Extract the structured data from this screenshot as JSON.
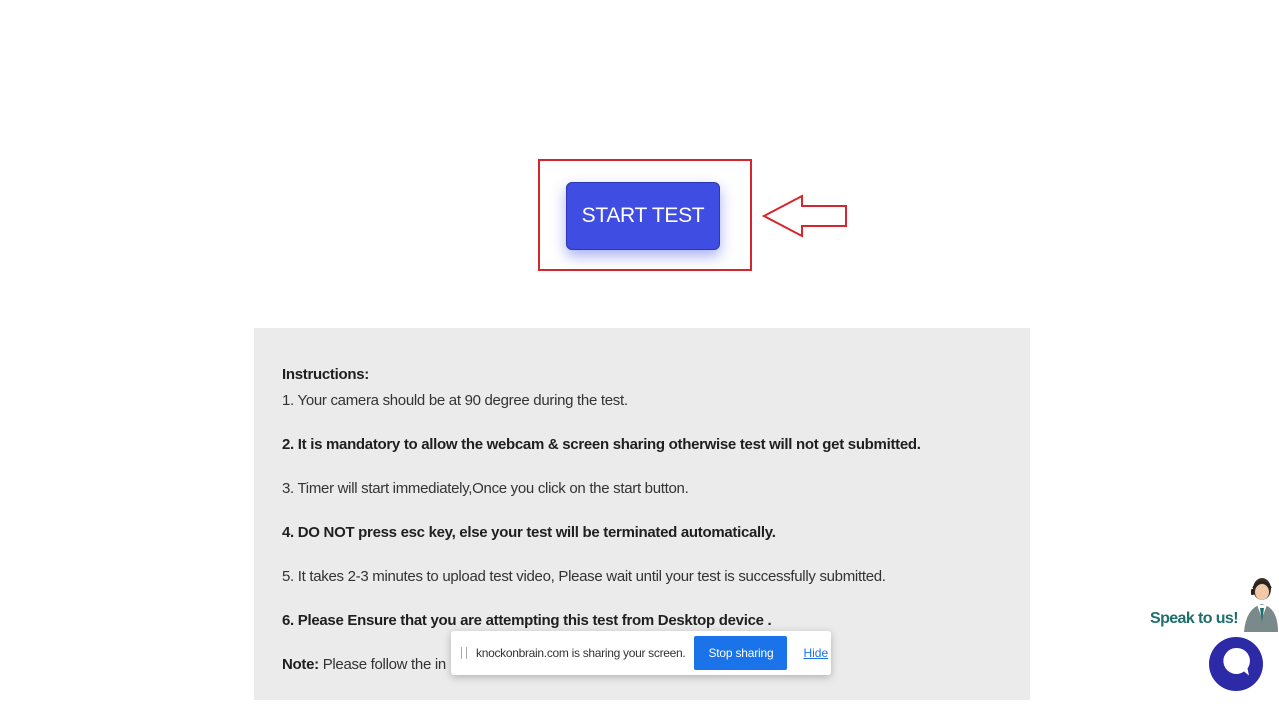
{
  "start_button": {
    "label": "START TEST"
  },
  "instructions": {
    "title": "Instructions:",
    "items": [
      "1. Your camera should be at 90 degree during the test.",
      "2. It is mandatory to allow the webcam & screen sharing otherwise test will not get submitted.",
      "3. Timer will start immediately,Once you click on the start button.",
      "4. DO NOT press esc key, else your test will be terminated automatically.",
      "5. It takes 2-3 minutes to upload test video, Please wait until your test is successfully submitted.",
      "6. Please Ensure that you are attempting this test from Desktop device ."
    ],
    "note_label": "Note:",
    "note_text": " Please follow the in"
  },
  "share_bar": {
    "message": "knockonbrain.com is sharing your screen.",
    "stop_label": "Stop sharing",
    "hide_label": "Hide"
  },
  "chat_widget": {
    "label": "Speak to us!"
  },
  "colors": {
    "highlight": "#d6262c",
    "start_button": "#3f4de3",
    "panel_bg": "#ebebeb",
    "stop_button": "#1a73e8",
    "chat_bubble": "#2c2aa7",
    "speak_text": "#1d6e6c"
  },
  "icons": [
    "arrow-left-outline-icon",
    "grip-icon",
    "agent-avatar-icon",
    "chat-bubble-icon"
  ]
}
